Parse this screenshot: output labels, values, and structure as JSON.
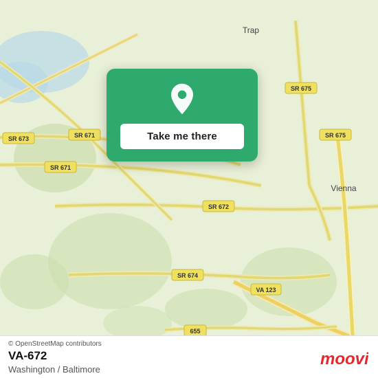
{
  "map": {
    "bg_color": "#e8f0d8",
    "center_lat": 38.87,
    "center_lon": -77.28
  },
  "card": {
    "button_label": "Take me there",
    "bg_color": "#2eaa6e",
    "pin_color": "white"
  },
  "bottom_bar": {
    "attribution": "© OpenStreetMap contributors",
    "location_name": "VA-672",
    "location_region": "Washington / Baltimore",
    "logo_text": "moovit"
  }
}
